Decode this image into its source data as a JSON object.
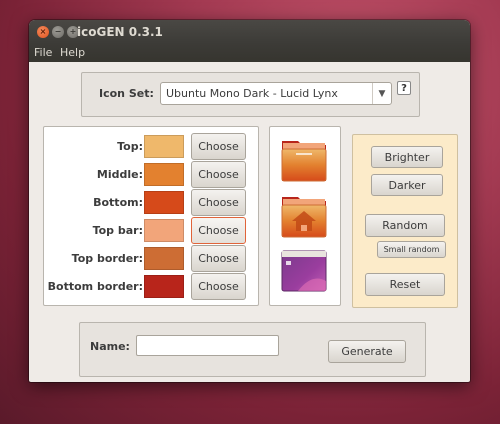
{
  "window": {
    "title": "icoGEN 0.3.1",
    "close_glyph": "×",
    "minimize_glyph": "−",
    "maximize_glyph": "+"
  },
  "menu": {
    "file": "File",
    "help": "Help"
  },
  "icon_set": {
    "label": "Icon Set:",
    "value": "Ubuntu Mono Dark - Lucid Lynx",
    "arrow": "▼",
    "help_glyph": "?"
  },
  "colors": [
    {
      "label": "Top:",
      "hex": "#efb86b",
      "button": "Choose"
    },
    {
      "label": "Middle:",
      "hex": "#e3812f",
      "button": "Choose"
    },
    {
      "label": "Bottom:",
      "hex": "#d64a1a",
      "button": "Choose"
    },
    {
      "label": "Top bar:",
      "hex": "#f2a57a",
      "button": "Choose"
    },
    {
      "label": "Top border:",
      "hex": "#cd6d34",
      "button": "Choose"
    },
    {
      "label": "Bottom border:",
      "hex": "#b8251b",
      "button": "Choose"
    }
  ],
  "previews": [
    "folder-icon",
    "home-folder-icon",
    "desktop-folder-icon"
  ],
  "actions": {
    "brighter": "Brighter",
    "darker": "Darker",
    "random": "Random",
    "small_random": "Small random",
    "reset": "Reset"
  },
  "footer": {
    "name_label": "Name:",
    "name_value": "",
    "generate": "Generate"
  }
}
